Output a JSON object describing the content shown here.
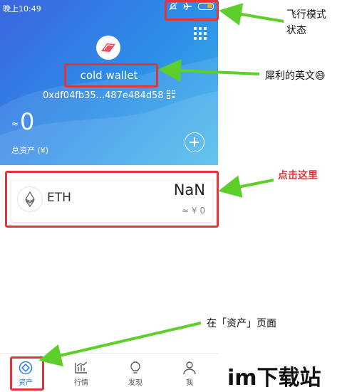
{
  "status_bar": {
    "time": "晚上10:49"
  },
  "wallet": {
    "name": "cold wallet",
    "address": "0xdf04fb35...487e484d58",
    "approx_symbol": "≈",
    "balance": "0",
    "total_label": "总资产 (¥)"
  },
  "assets": [
    {
      "symbol": "ETH",
      "amount": "NaN",
      "value": "≈ ¥ 0"
    }
  ],
  "tabbar": {
    "tabs": [
      {
        "label": "资产",
        "icon": "asset-icon",
        "active": true
      },
      {
        "label": "行情",
        "icon": "chart-icon",
        "active": false
      },
      {
        "label": "发现",
        "icon": "bulb-icon",
        "active": false
      },
      {
        "label": "我",
        "icon": "person-icon",
        "active": false
      }
    ]
  },
  "annotations": {
    "airplane_mode": "飞行模式\n状态",
    "english_name": "犀利的英文😄",
    "click_here": "点击这里",
    "assets_page": "在「资产」页面"
  },
  "watermark": "im下载站",
  "colors": {
    "header_start": "#3c66e0",
    "header_end": "#3fb7ea",
    "accent": "#2a7be4",
    "annotation_red": "#e2343a",
    "arrow_green": "#5ccf2a"
  }
}
